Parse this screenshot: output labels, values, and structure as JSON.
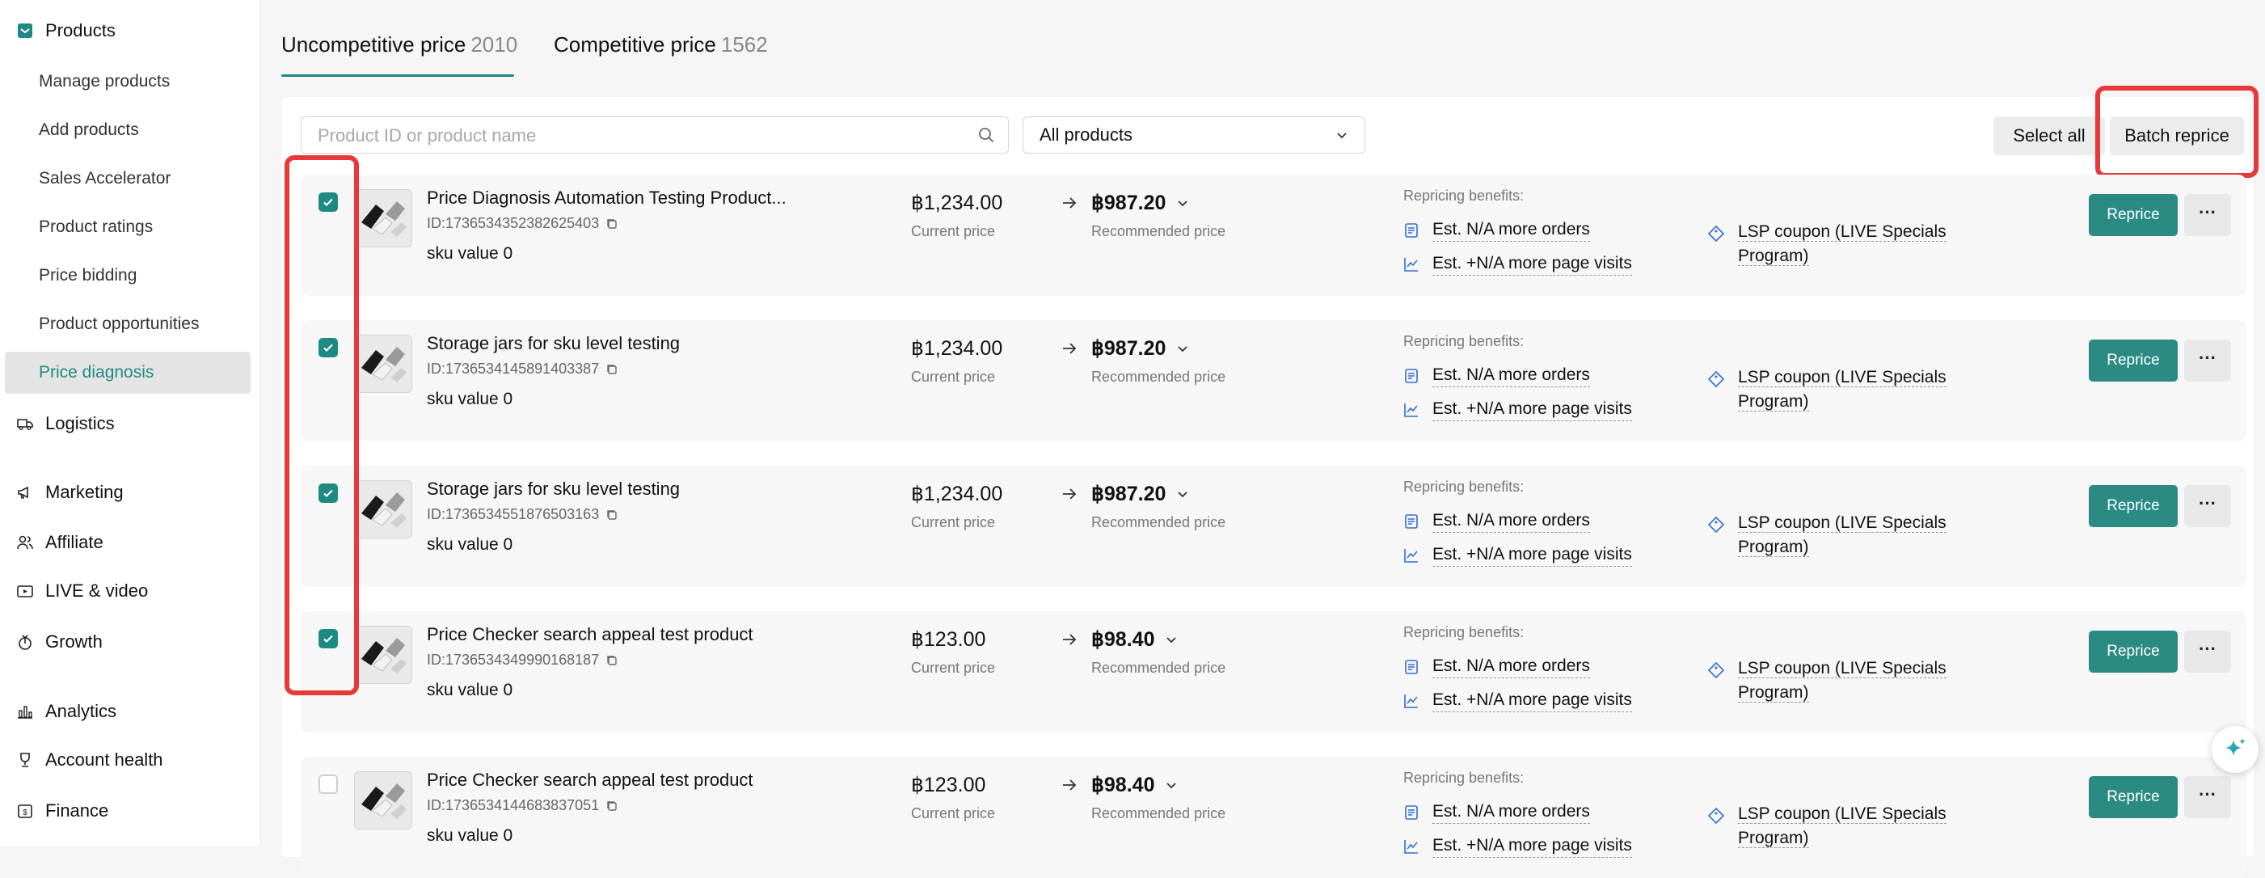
{
  "sidebar": {
    "top": {
      "label": "Products",
      "icon": "products-icon"
    },
    "sub_items": [
      {
        "label": "Manage products"
      },
      {
        "label": "Add products"
      },
      {
        "label": "Sales Accelerator"
      },
      {
        "label": "Product ratings"
      },
      {
        "label": "Price bidding"
      },
      {
        "label": "Product opportunities"
      },
      {
        "label": "Price diagnosis",
        "active": true
      }
    ],
    "main_items": [
      {
        "label": "Logistics",
        "icon": "truck-icon"
      },
      {
        "label": "Marketing",
        "icon": "megaphone-icon"
      },
      {
        "label": "Affiliate",
        "icon": "users-icon"
      },
      {
        "label": "LIVE & video",
        "icon": "video-icon"
      },
      {
        "label": "Growth",
        "icon": "growth-icon"
      },
      {
        "label": "Analytics",
        "icon": "bar-chart-icon"
      },
      {
        "label": "Account health",
        "icon": "trophy-icon"
      },
      {
        "label": "Finance",
        "icon": "wallet-icon"
      }
    ]
  },
  "tabs": [
    {
      "label": "Uncompetitive price",
      "count": "2010",
      "active": true
    },
    {
      "label": "Competitive price",
      "count": "1562",
      "active": false
    }
  ],
  "toolbar": {
    "search_placeholder": "Product ID or product name",
    "filter_value": "All products",
    "select_all": "Select all",
    "batch_reprice": "Batch reprice"
  },
  "labels": {
    "current_price": "Current price",
    "recommended_price": "Recommended price",
    "benefits_title": "Repricing benefits:",
    "benefit_orders": "Est. N/A more orders",
    "benefit_visits": "Est. +N/A more page visits",
    "coupon_line1": "LSP coupon (LIVE Specials",
    "coupon_line2": "Program)",
    "reprice": "Reprice",
    "more": "···"
  },
  "products": [
    {
      "name": "Price Diagnosis Automation Testing Product...",
      "id": "ID:1736534352382625403",
      "sku": "sku value 0",
      "current_price": "฿1,234.00",
      "recommended_price": "฿987.20",
      "checked": true
    },
    {
      "name": "Storage jars for sku level testing",
      "id": "ID:1736534145891403387",
      "sku": "sku value 0",
      "current_price": "฿1,234.00",
      "recommended_price": "฿987.20",
      "checked": true
    },
    {
      "name": "Storage jars for sku level testing",
      "id": "ID:1736534551876503163",
      "sku": "sku value 0",
      "current_price": "฿1,234.00",
      "recommended_price": "฿987.20",
      "checked": true
    },
    {
      "name": "Price Checker search appeal test product",
      "id": "ID:1736534349990168187",
      "sku": "sku value 0",
      "current_price": "฿123.00",
      "recommended_price": "฿98.40",
      "checked": true
    },
    {
      "name": "Price Checker search appeal test product",
      "id": "ID:1736534144683837051",
      "sku": "sku value 0",
      "current_price": "฿123.00",
      "recommended_price": "฿98.40",
      "checked": false
    }
  ],
  "colors": {
    "accent": "#2b8a84",
    "highlight": "#e8393a"
  }
}
